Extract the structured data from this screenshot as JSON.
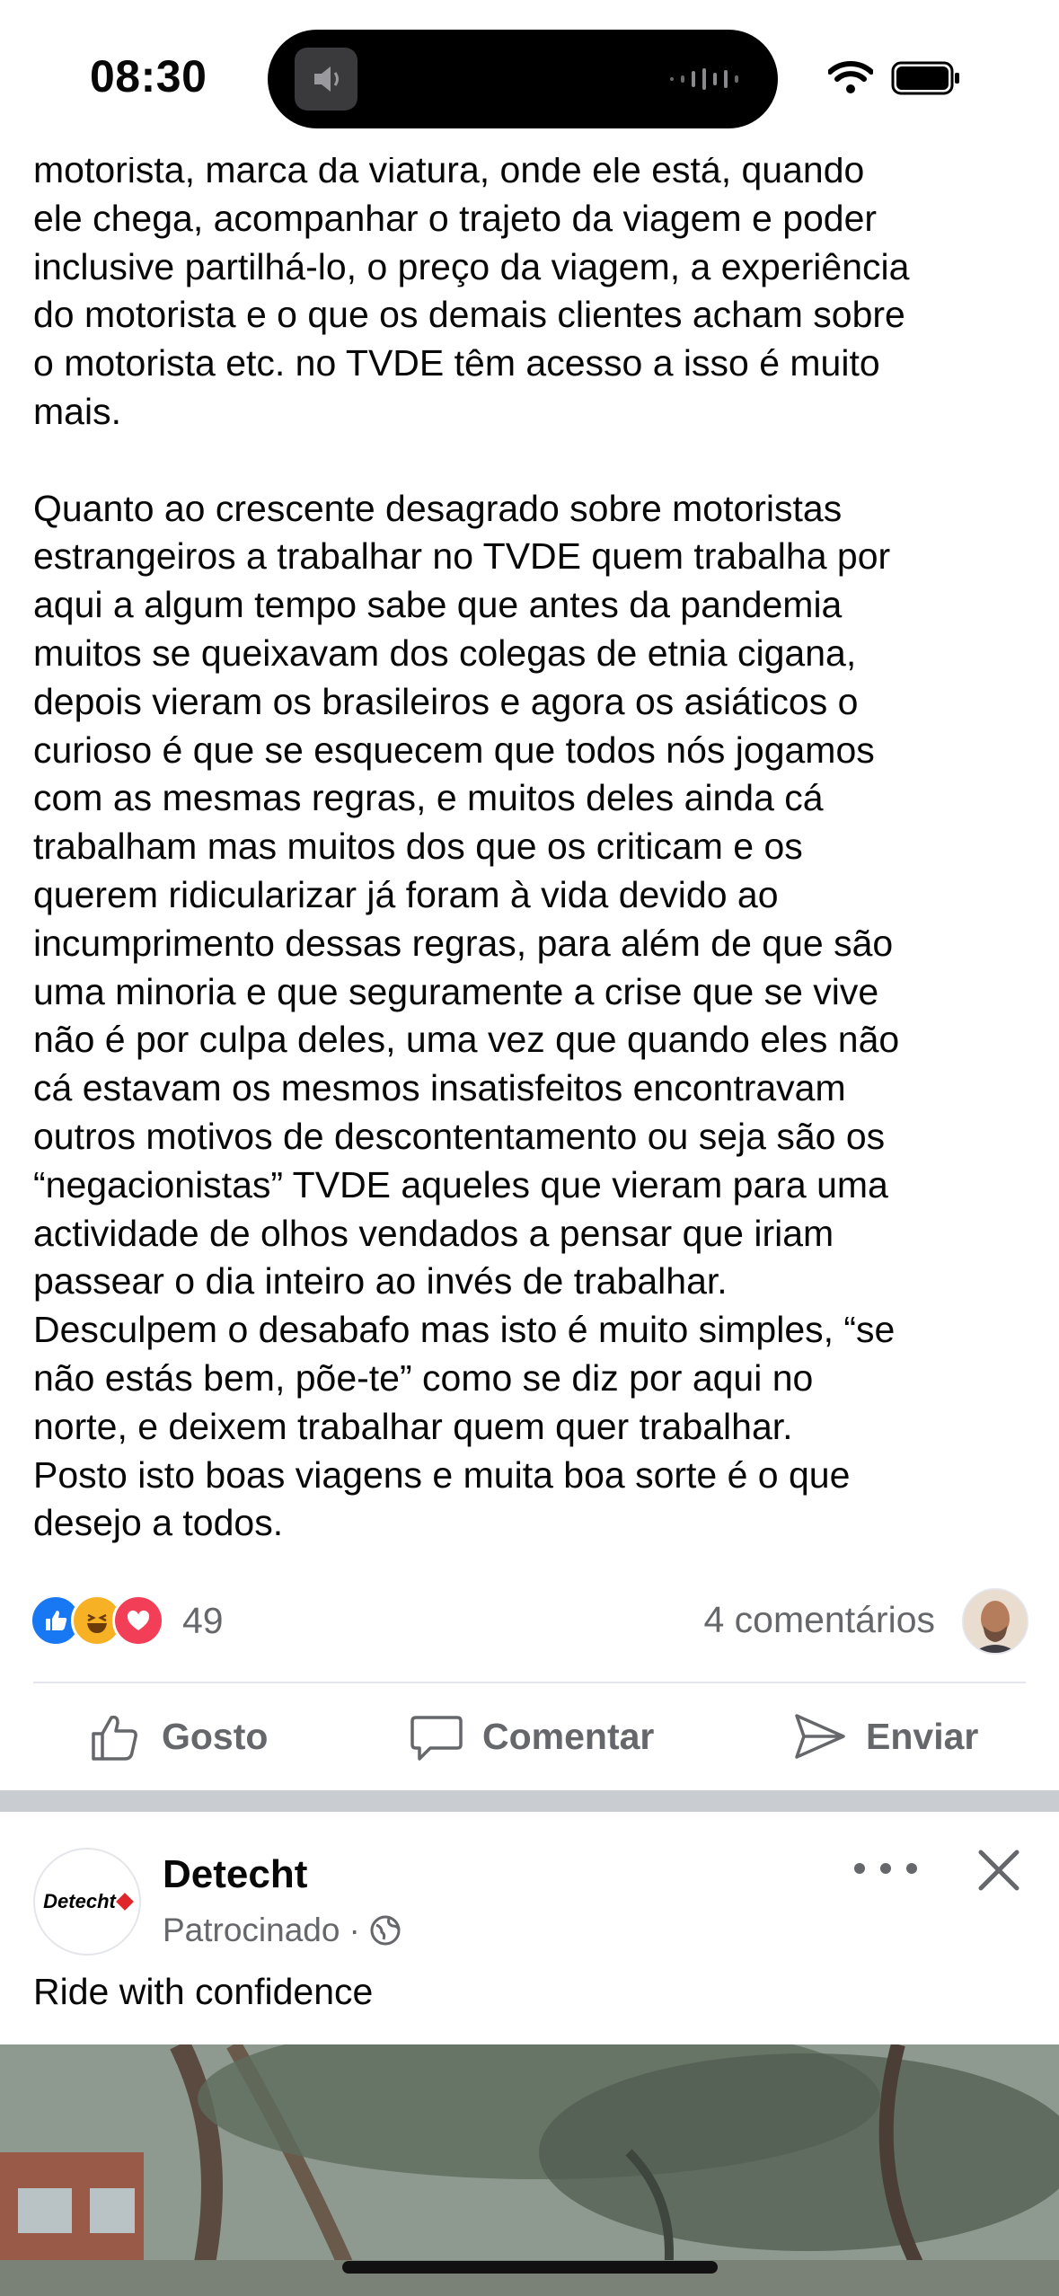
{
  "status_bar": {
    "time": "08:30"
  },
  "post": {
    "text": "motorista, marca da viatura, onde ele está, quando\nele chega, acompanhar o trajeto da viagem e poder\ninclusive partilhá-lo, o preço da viagem, a experiência\ndo motorista e o que os demais clientes acham sobre\no motorista etc. no TVDE têm acesso a isso é muito\nmais.\n\nQuanto ao crescente desagrado sobre motoristas\nestrangeiros a trabalhar no TVDE quem trabalha por\naqui a algum tempo sabe que antes da pandemia\nmuitos se queixavam dos colegas de etnia cigana,\ndepois vieram os brasileiros e agora os asiáticos o\ncurioso é que se esquecem que todos nós jogamos\ncom as mesmas regras, e muitos deles ainda cá\ntrabalham mas muitos dos que os criticam e os\nquerem ridicularizar já foram à vida devido ao\nincumprimento dessas regras, para além de que são\numa minoria e que seguramente a crise que se vive\nnão é por culpa deles, uma vez que quando eles não\ncá estavam os mesmos insatisfeitos encontravam\noutros motivos de descontentamento ou seja são os\n“negacionistas” TVDE aqueles que vieram para uma\nactividade de olhos vendados a pensar que iriam\npassear o dia inteiro ao invés de trabalhar.\nDesculpem o desabafo mas isto é muito simples, “se\nnão estás bem, põe-te” como se diz por aqui no\nnorte, e deixem trabalhar quem quer trabalhar.\nPosto isto boas viagens e muita boa sorte é o que\ndesejo a todos.",
    "reaction_count": "49",
    "reaction_icons": [
      "like-icon",
      "haha-icon",
      "love-icon"
    ],
    "comments_label": "4 comentários"
  },
  "actions": {
    "like_label": "Gosto",
    "comment_label": "Comentar",
    "send_label": "Enviar"
  },
  "sponsored": {
    "logo_text": "Detecht",
    "page_name": "Detecht",
    "sponsored_label": "Patrocinado",
    "caption": "Ride with confidence"
  },
  "colors": {
    "like_blue": "#1877f2",
    "haha_yellow": "#f7b125",
    "love_red": "#f33e58",
    "secondary_text": "#65676b"
  }
}
